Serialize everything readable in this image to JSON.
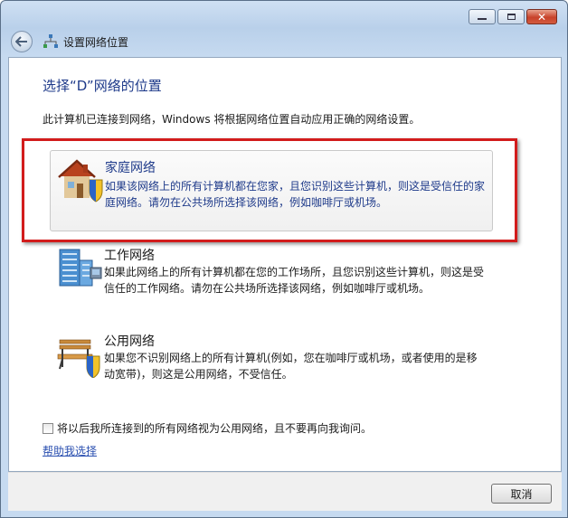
{
  "window": {
    "breadcrumb": "设置网络位置",
    "controls": {
      "minimize_icon": "minimize-icon",
      "maximize_icon": "maximize-icon",
      "close_icon": "close-icon"
    }
  },
  "page": {
    "title": "选择“D”网络的位置",
    "intro": "此计算机已连接到网络，Windows 将根据网络位置自动应用正确的网络设置。"
  },
  "options": [
    {
      "title": "家庭网络",
      "desc_line1": "如果该网络上的所有计算机都在您家，且您识别这些计算机，则这是受信任的家",
      "desc_line2": "庭网络。请勿在公共场所选择该网络，例如咖啡厅或机场。",
      "icon": "house-shield-icon",
      "selected": true
    },
    {
      "title": "工作网络",
      "desc_line1": "如果此网络上的所有计算机都在您的工作场所，且您识别这些计算机，则这是受",
      "desc_line2": "信任的工作网络。请勿在公共场所选择该网络，例如咖啡厅或机场。",
      "icon": "office-building-icon",
      "selected": false
    },
    {
      "title": "公用网络",
      "desc_line1": "如果您不识别网络上的所有计算机(例如，您在咖啡厅或机场，或者使用的是移",
      "desc_line2": "动宽带)，则这是公用网络，不受信任。",
      "icon": "park-bench-shield-icon",
      "selected": false
    }
  ],
  "checkbox": {
    "label": "将以后我所连接到的所有网络视为公用网络，且不要再向我询问。",
    "checked": false
  },
  "help_link": "帮助我选择",
  "buttons": {
    "cancel": "取消"
  },
  "colors": {
    "heading_blue": "#1e3a8a",
    "highlight_red": "#d21c1c",
    "link_blue": "#2a4fb0"
  }
}
